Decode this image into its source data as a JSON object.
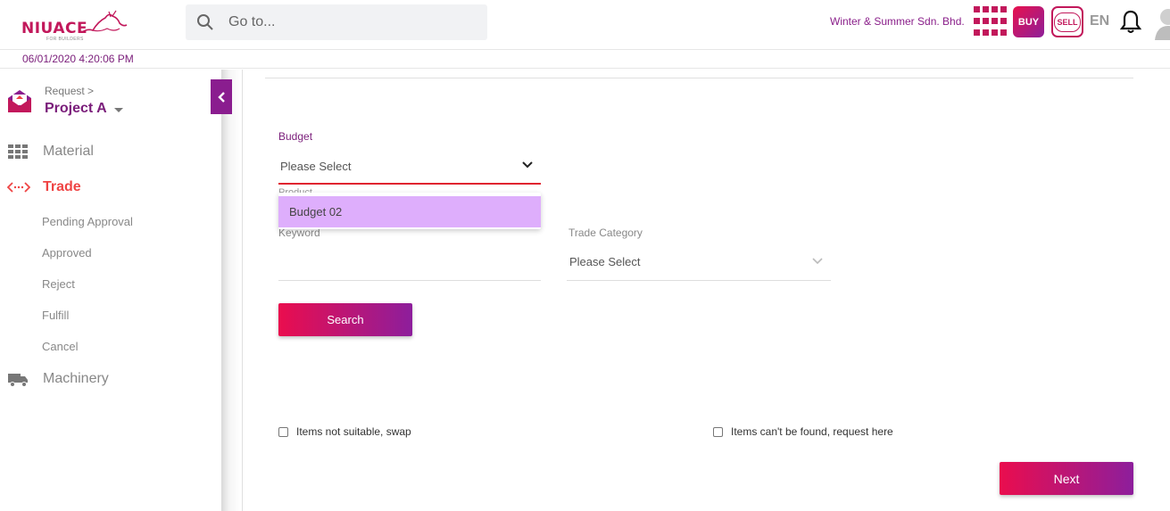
{
  "header": {
    "logo_text": "NIUACE",
    "logo_sub": "FOR BUILDERS",
    "search_placeholder": "Go to...",
    "company": "Winter & Summer Sdn. Bhd.",
    "buy_label": "BUY",
    "sell_label": "SELL",
    "language": "EN",
    "datetime": "06/01/2020 4:20:06 PM"
  },
  "sidebar": {
    "breadcrumb": "Request >",
    "project": "Project A",
    "items": [
      {
        "label": "Material",
        "icon": "grid-icon",
        "active": false
      },
      {
        "label": "Trade",
        "icon": "code-arrows-icon",
        "active": true
      },
      {
        "label": "Machinery",
        "icon": "truck-icon",
        "active": false
      }
    ],
    "sub_items": [
      "Pending Approval",
      "Approved",
      "Reject",
      "Fulfill",
      "Cancel"
    ]
  },
  "form": {
    "budget_label": "Budget",
    "budget_value": "Please Select",
    "hidden_label": "Product",
    "keyword_label": "Keyword",
    "keyword_value": "",
    "trade_category_label": "Trade Category",
    "trade_category_value": "Please Select",
    "dropdown_options": [
      "Budget 02"
    ],
    "search_button": "Search",
    "checkbox_swap": "Items not suitable, swap",
    "checkbox_request": "Items can't be found, request here",
    "next_button": "Next"
  },
  "colors": {
    "brand": "#c2185b",
    "purple": "#7a1d7a",
    "active_nav": "#ef4444",
    "dropdown_highlight": "#deaefc"
  }
}
